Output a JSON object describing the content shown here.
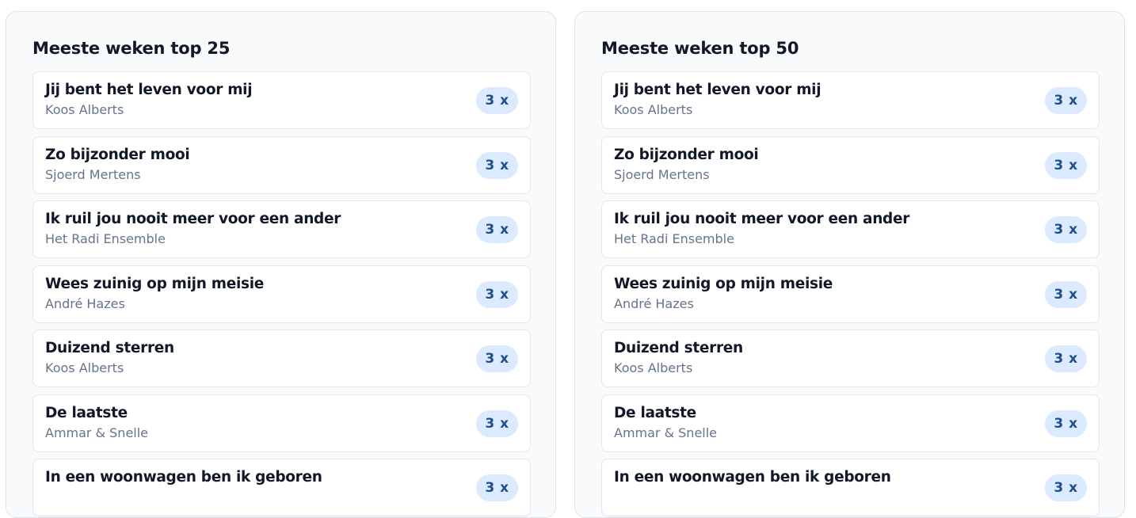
{
  "panels": [
    {
      "title": "Meeste weken top 25",
      "items": [
        {
          "title": "Jij bent het leven voor mij",
          "artist": "Koos Alberts",
          "count": "3 x"
        },
        {
          "title": "Zo bijzonder mooi",
          "artist": "Sjoerd Mertens",
          "count": "3 x"
        },
        {
          "title": "Ik ruil jou nooit meer voor een ander",
          "artist": "Het Radi Ensemble",
          "count": "3 x"
        },
        {
          "title": "Wees zuinig op mijn meisie",
          "artist": "André Hazes",
          "count": "3 x"
        },
        {
          "title": "Duizend sterren",
          "artist": "Koos Alberts",
          "count": "3 x"
        },
        {
          "title": "De laatste",
          "artist": "Ammar & Snelle",
          "count": "3 x"
        },
        {
          "title": "In een woonwagen ben ik geboren",
          "artist": "",
          "count": "3 x"
        }
      ]
    },
    {
      "title": "Meeste weken top 50",
      "items": [
        {
          "title": "Jij bent het leven voor mij",
          "artist": "Koos Alberts",
          "count": "3 x"
        },
        {
          "title": "Zo bijzonder mooi",
          "artist": "Sjoerd Mertens",
          "count": "3 x"
        },
        {
          "title": "Ik ruil jou nooit meer voor een ander",
          "artist": "Het Radi Ensemble",
          "count": "3 x"
        },
        {
          "title": "Wees zuinig op mijn meisie",
          "artist": "André Hazes",
          "count": "3 x"
        },
        {
          "title": "Duizend sterren",
          "artist": "Koos Alberts",
          "count": "3 x"
        },
        {
          "title": "De laatste",
          "artist": "Ammar & Snelle",
          "count": "3 x"
        },
        {
          "title": "In een woonwagen ben ik geboren",
          "artist": "",
          "count": "3 x"
        }
      ]
    }
  ]
}
